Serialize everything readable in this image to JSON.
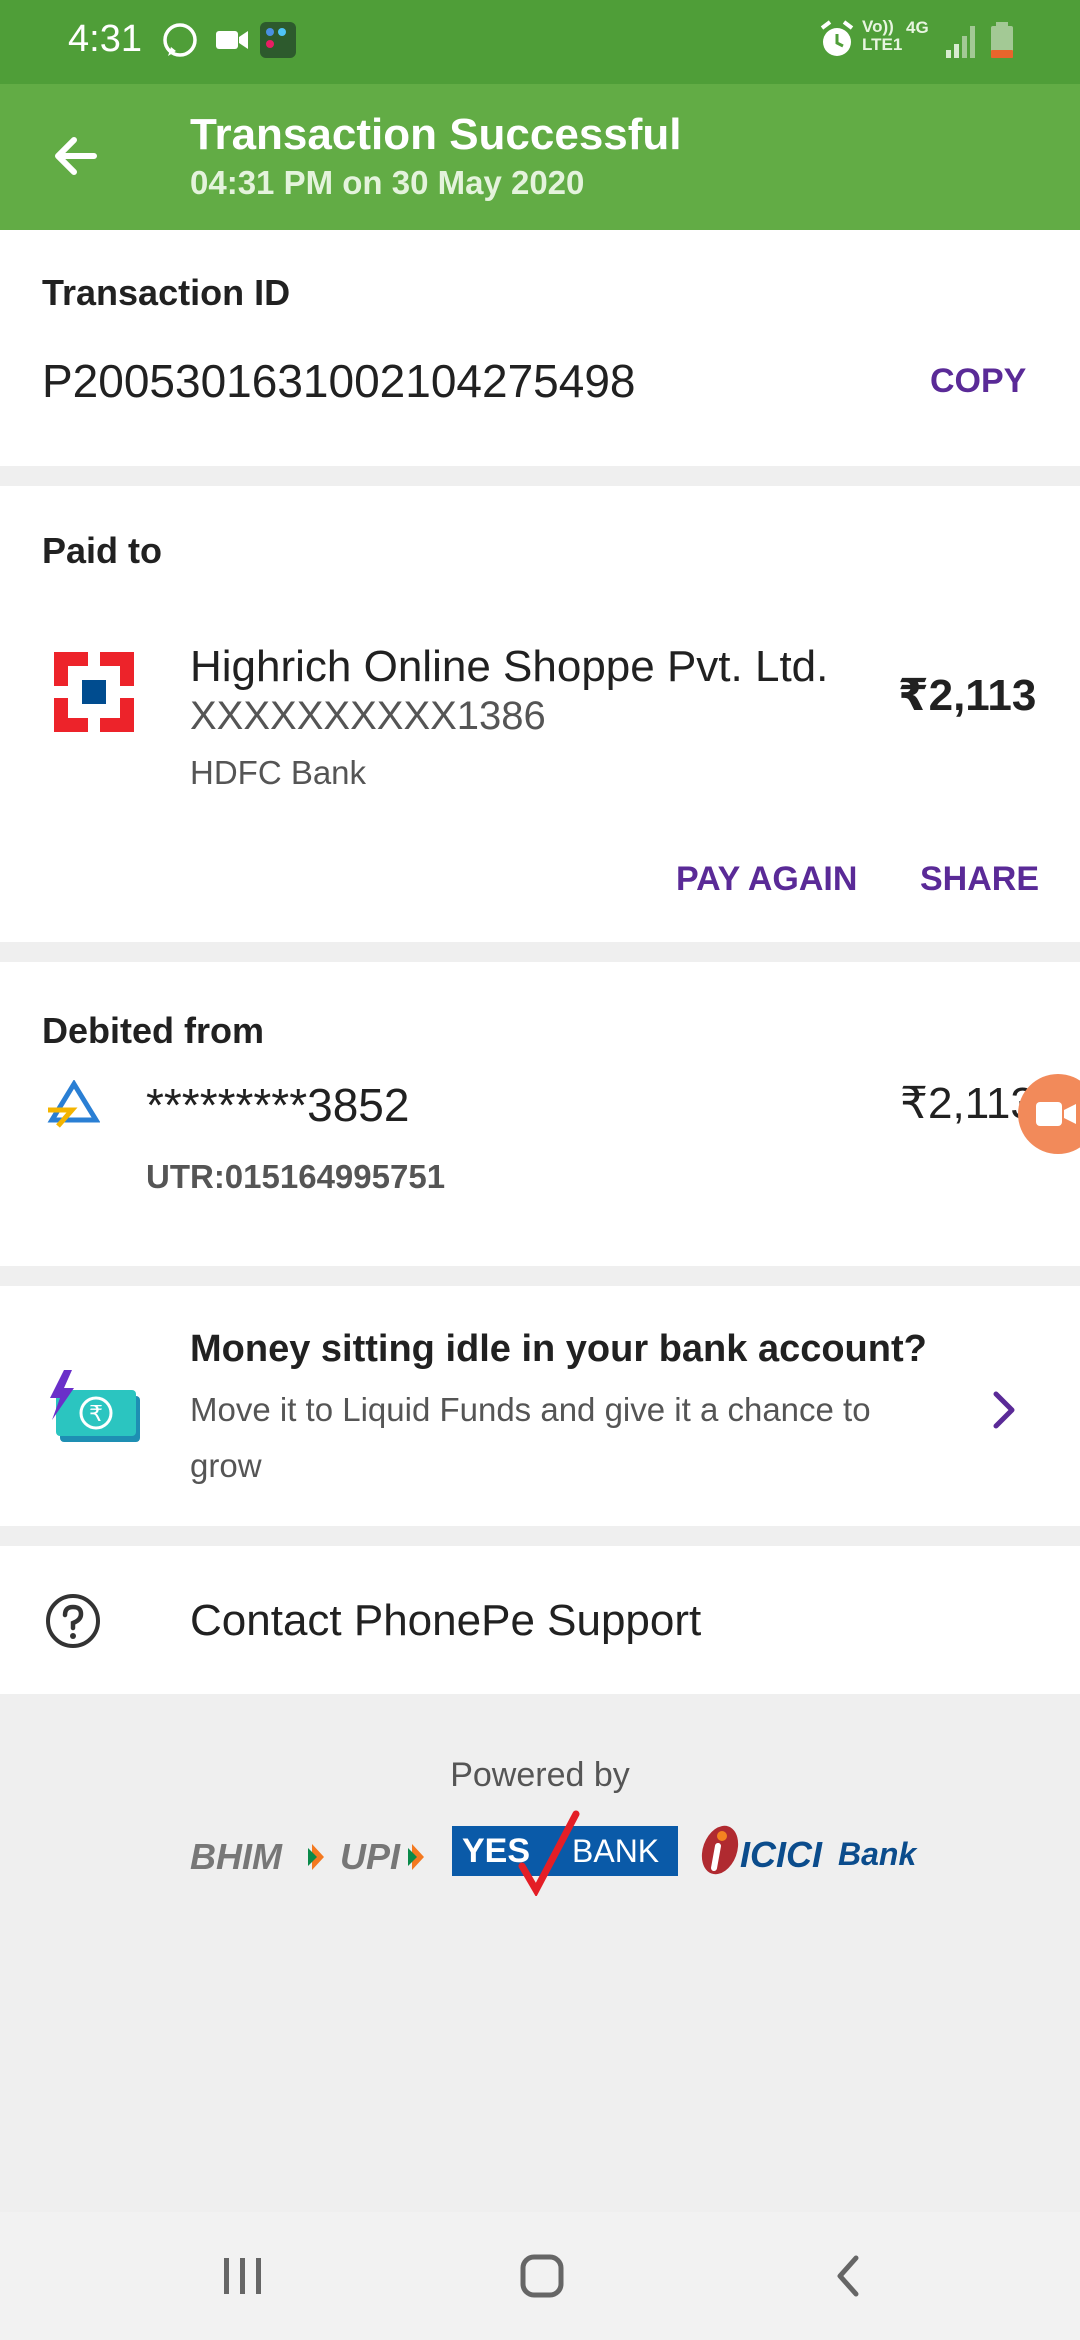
{
  "status_bar": {
    "time": "4:31",
    "icons_left": [
      "whatsapp-icon",
      "video-call-icon",
      "app-folder-icon"
    ],
    "icons_right": [
      "alarm-icon",
      "volte-icon",
      "network-4g-icon",
      "signal-icon",
      "battery-icon"
    ],
    "volte_text": "Vo))\nLTE1",
    "network_text": "4G"
  },
  "header": {
    "title": "Transaction Successful",
    "subtitle": "04:31 PM on 30 May 2020"
  },
  "transaction": {
    "label": "Transaction ID",
    "id": "P2005301631002104275498",
    "copy_label": "COPY"
  },
  "paid_to": {
    "label": "Paid to",
    "name": "Highrich Online Shoppe Pvt. Ltd.",
    "account": "XXXXXXXXXX1386",
    "bank": "HDFC Bank",
    "amount": "₹2,113",
    "pay_again_label": "PAY AGAIN",
    "share_label": "SHARE"
  },
  "debited_from": {
    "label": "Debited from",
    "account": "*********3852",
    "utr": "UTR:015164995751",
    "amount": "₹2,113"
  },
  "promo": {
    "title": "Money sitting idle in your bank account?",
    "body": "Move it to Liquid Funds and give it a chance to grow"
  },
  "support": {
    "label": "Contact PhonePe Support"
  },
  "footer": {
    "powered_by": "Powered by",
    "logos": {
      "bhim": "BHIM",
      "upi": "UPI",
      "yes_bank": "YES",
      "yes_bank_2": "BANK",
      "icici": "ICICI",
      "icici_2": "Bank"
    }
  },
  "colors": {
    "status_bar": "#4f9e38",
    "app_bar": "#62ac45",
    "accent": "#5a2a97"
  }
}
